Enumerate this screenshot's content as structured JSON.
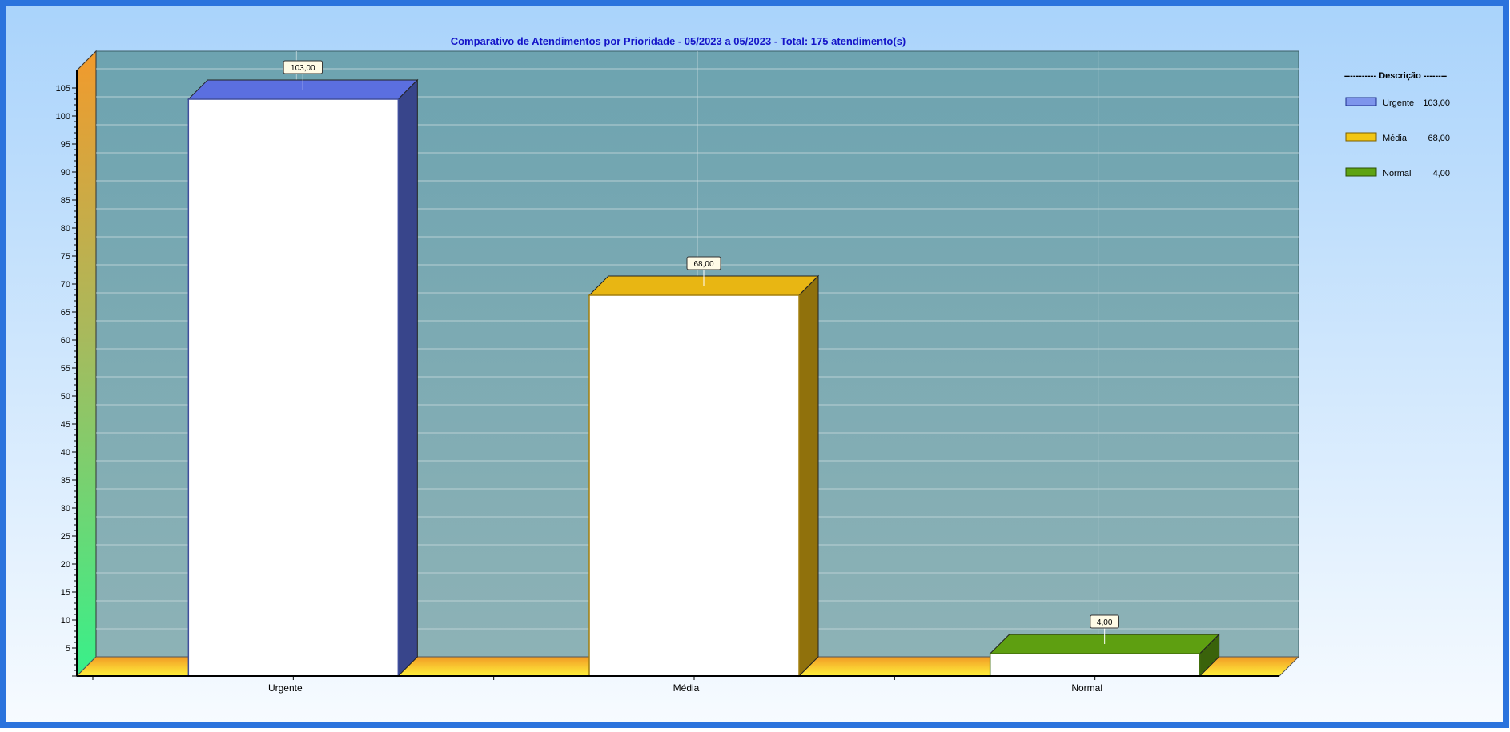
{
  "chart_data": {
    "type": "bar",
    "title": "Comparativo de Atendimentos por Prioridade - 05/2023 a 05/2023 - Total: 175 atendimento(s)",
    "categories": [
      "Urgente",
      "Média",
      "Normal"
    ],
    "values": [
      103,
      68,
      4
    ],
    "value_labels": [
      "103,00",
      "68,00",
      "4,00"
    ],
    "colors": [
      "#5b6fe0",
      "#e8b613",
      "#5e9f11"
    ],
    "ylim": [
      0,
      105
    ],
    "yticks": [
      5,
      10,
      15,
      20,
      25,
      30,
      35,
      40,
      45,
      50,
      55,
      60,
      65,
      70,
      75,
      80,
      85,
      90,
      95,
      100,
      105
    ],
    "xlabel": "",
    "ylabel": "",
    "grid": true,
    "legend_position": "right",
    "legend": {
      "header": "----------- Descrição --------",
      "items": [
        {
          "label": "Urgente",
          "value": "103,00",
          "color": "#7e95ec"
        },
        {
          "label": "Média",
          "value": "68,00",
          "color": "#f2c614"
        },
        {
          "label": "Normal",
          "value": "4,00",
          "color": "#5ea312"
        }
      ]
    }
  },
  "colors": {
    "frame_border": "#2b73dd",
    "background_top": "#a9d3fb",
    "background_bottom": "#f7fbff",
    "plot_top": "#6da3b0",
    "plot_bottom": "#8db2b6",
    "floor_top": "#f29a24",
    "floor_bottom": "#fff23c",
    "title": "#1414c8"
  }
}
